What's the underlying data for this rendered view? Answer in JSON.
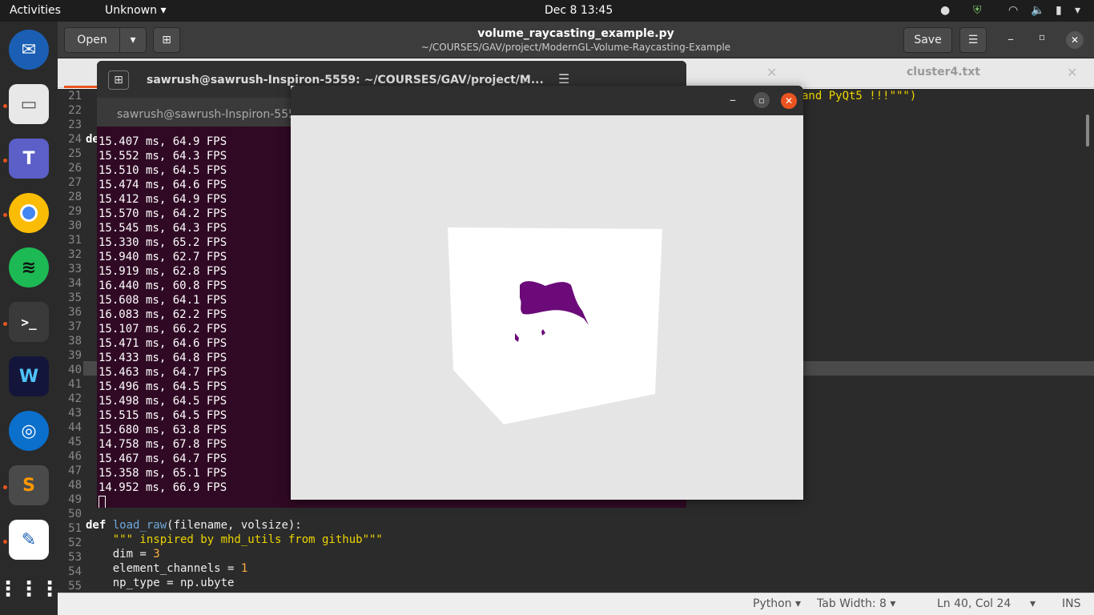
{
  "topbar": {
    "activities": "Activities",
    "app_menu": "Unknown",
    "clock": "Dec 8  13:45"
  },
  "gedit": {
    "open_label": "Open",
    "save_label": "Save",
    "title": "volume_raycasting_example.py",
    "subtitle": "~/COURSES/GAV/project/ModernGL-Volume-Raycasting-Example",
    "tab2": "cluster4.txt",
    "status": {
      "language": "Python",
      "tab_width": "Tab Width: 8",
      "position": "Ln 40, Col 24",
      "mode": "INS"
    },
    "code_fragment_top": "and PyQt5 !!!\"\"\")",
    "code_fragment_de": "de",
    "lines": {
      "l51_kw": "def ",
      "l51_fn": "load_raw",
      "l51_rest": "(filename, volsize):",
      "l52": "    \"\"\" inspired by mhd_utils from github\"\"\"",
      "l53_a": "    dim = ",
      "l53_b": "3",
      "l54_a": "    element_channels = ",
      "l54_b": "1",
      "l55": "    np_type = np.ubyte"
    }
  },
  "terminal": {
    "title": "sawrush@sawrush-Inspiron-5559: ~/COURSES/GAV/project/M...",
    "tab": "sawrush@sawrush-Inspiron-5559",
    "output": [
      "15.407 ms, 64.9 FPS",
      "15.552 ms, 64.3 FPS",
      "15.510 ms, 64.5 FPS",
      "15.474 ms, 64.6 FPS",
      "15.412 ms, 64.9 FPS",
      "15.570 ms, 64.2 FPS",
      "15.545 ms, 64.3 FPS",
      "15.330 ms, 65.2 FPS",
      "15.940 ms, 62.7 FPS",
      "15.919 ms, 62.8 FPS",
      "16.440 ms, 60.8 FPS",
      "15.608 ms, 64.1 FPS",
      "16.083 ms, 62.2 FPS",
      "15.107 ms, 66.2 FPS",
      "15.471 ms, 64.6 FPS",
      "15.433 ms, 64.8 FPS",
      "15.463 ms, 64.7 FPS",
      "15.496 ms, 64.5 FPS",
      "15.498 ms, 64.5 FPS",
      "15.515 ms, 64.5 FPS",
      "15.680 ms, 63.8 FPS",
      "14.758 ms, 67.8 FPS",
      "15.467 ms, 64.7 FPS",
      "15.358 ms, 65.1 FPS",
      "14.952 ms, 66.9 FPS"
    ]
  },
  "line_numbers": [
    "21",
    "22",
    "23",
    "24",
    "25",
    "26",
    "27",
    "28",
    "29",
    "30",
    "31",
    "32",
    "33",
    "34",
    "35",
    "36",
    "37",
    "38",
    "39",
    "40",
    "41",
    "42",
    "43",
    "44",
    "45",
    "46",
    "47",
    "48",
    "49",
    "50",
    "51",
    "52",
    "53",
    "54",
    "55"
  ],
  "colors": {
    "accent": "#e95420",
    "terminal_bg": "#300a24",
    "volume": "#6b0a78"
  },
  "dock": [
    "thunderbird-icon",
    "files-icon",
    "teams-icon",
    "chrome-icon",
    "spotify-icon",
    "terminal-icon",
    "webex-icon",
    "app-icon",
    "sublime-icon",
    "text-editor-icon",
    "app-grid-icon"
  ]
}
